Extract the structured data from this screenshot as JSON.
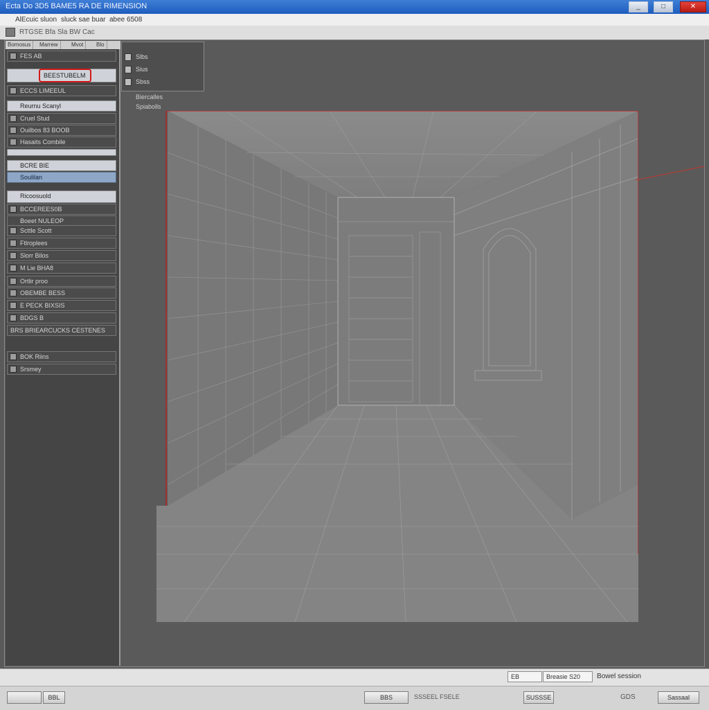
{
  "window": {
    "title": "Ecta  Do  3D5 BAME5 RA DE RIMENSION",
    "buttons": {
      "minimize": "_",
      "maximize": "□",
      "close": "✕"
    },
    "colors": {
      "titlebar": "#1d5cbd",
      "close": "#c4241c",
      "selection": "#d21818"
    }
  },
  "menubar": {
    "items": [
      "AlEcuic sluon",
      "sluck sae  buar",
      "abee 6508"
    ]
  },
  "toolbar": {
    "label": "RTGSE  Bfa  Sla  BW  Cac"
  },
  "left_panel": {
    "tabs": [
      "Bomosus",
      "Marrew",
      "Mvot",
      "Blo"
    ],
    "header": "FES  AB",
    "highlight_label": "BEESTUBELM",
    "rows": [
      {
        "label": "ECCS LIMEEUL",
        "icon": "layer-icon"
      },
      {
        "label": "Reurnu Scanyl",
        "icon": "layer-icon"
      },
      {
        "label": "Cruel Stud",
        "icon": "layer-icon"
      },
      {
        "label": "Ouilbos 83 BOOB",
        "icon": "layer-icon"
      },
      {
        "label": "Hasaits Combile",
        "icon": "layer-icon"
      },
      {
        "label": "BCRE BIE",
        "icon": "layer-icon"
      },
      {
        "label": "Soulilan",
        "icon": "layer-icon"
      },
      {
        "label": "Ricoosuold",
        "icon": "layer-icon"
      },
      {
        "label": "BCCEREES0B",
        "icon": "layer-icon"
      },
      {
        "label": "Scttle Scott",
        "icon": "layer-icon"
      },
      {
        "label": "Ftlroplees",
        "icon": "layer-icon"
      },
      {
        "label": "Slorr Bilos",
        "icon": "layer-icon"
      },
      {
        "label": "M Lie  BHA8",
        "icon": "layer-icon"
      },
      {
        "label": "Ortlir proo",
        "icon": "layer-icon"
      },
      {
        "label": "OBEMBE BESS",
        "icon": "layer-icon"
      },
      {
        "label": "E PECK BIXSIS",
        "icon": "layer-icon"
      },
      {
        "label": "BDGS B",
        "icon": "layer-icon"
      },
      {
        "label": "Boeet NULEOP",
        "icon": "layer-icon"
      },
      {
        "label": "BRS BRIEARCUCKS CESTENES",
        "icon": "layer-icon"
      },
      {
        "label": "BOK Riins",
        "icon": "layer-icon"
      },
      {
        "label": "Srsmey",
        "icon": "layer-icon"
      }
    ]
  },
  "tool_panel": {
    "rows": [
      {
        "label": "Slbs"
      },
      {
        "label": "Sius"
      },
      {
        "label": "Sbss"
      }
    ],
    "sublabels": [
      "Biercalles",
      "Spiabolls"
    ]
  },
  "status": {
    "field1": "EB",
    "field2": "Breasie  S20",
    "right_text": "Bowel session"
  },
  "bottom": {
    "left_field": "",
    "left_button": "BBL",
    "center_button": "BBS",
    "center_text": "SSSEEL  FSELE",
    "right_button": "SUSSSE",
    "right_text": "GDS",
    "far_button": "Sassaal"
  }
}
